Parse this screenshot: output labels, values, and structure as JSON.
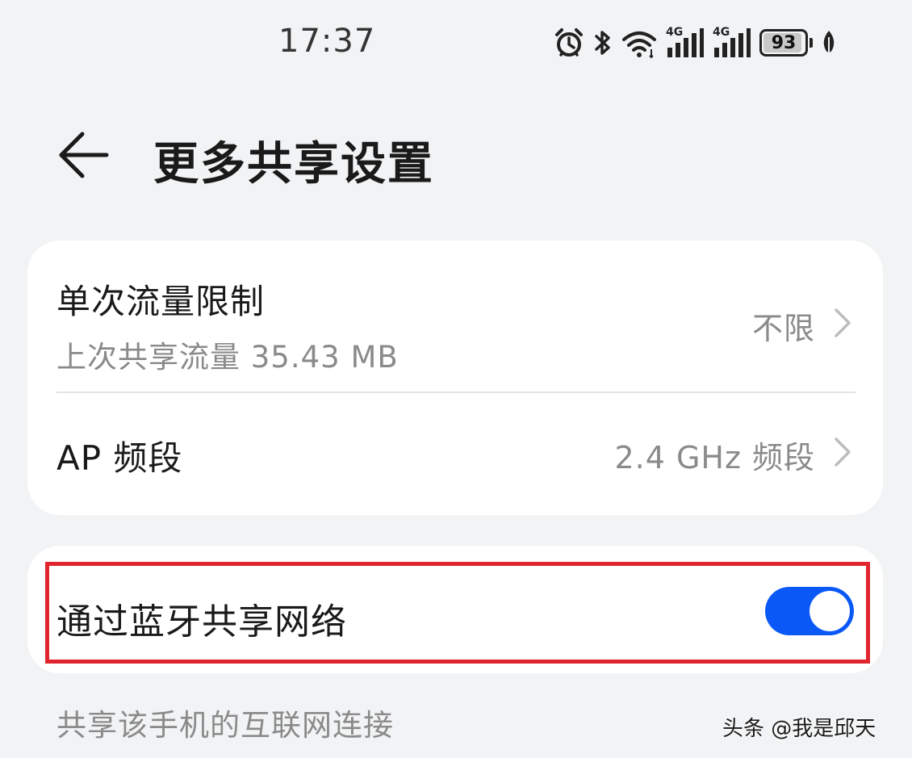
{
  "status_bar": {
    "time": "17:37",
    "icons": [
      "alarm-icon",
      "bluetooth-icon",
      "wifi-icon",
      "signal-4g-icon",
      "signal-4g-icon",
      "battery-icon",
      "leaf-icon"
    ],
    "signal_1_label": "4G",
    "signal_2_label": "4G",
    "battery_level": "93",
    "battery_fraction": 0.93
  },
  "header": {
    "back_icon": "arrow-left-icon",
    "title": "更多共享设置"
  },
  "settings": {
    "data_limit": {
      "title": "单次流量限制",
      "subtitle": "上次共享流量 35.43 MB",
      "value": "不限"
    },
    "ap_band": {
      "title": "AP 频段",
      "value": "2.4 GHz 频段"
    }
  },
  "bluetooth_sharing": {
    "title": "通过蓝牙共享网络",
    "enabled": true,
    "description": "共享该手机的互联网连接"
  },
  "colors": {
    "accent": "#0a59f7",
    "highlight": "#e0252e",
    "background": "#f1f3f5"
  },
  "watermark": "头条 @我是邱天"
}
